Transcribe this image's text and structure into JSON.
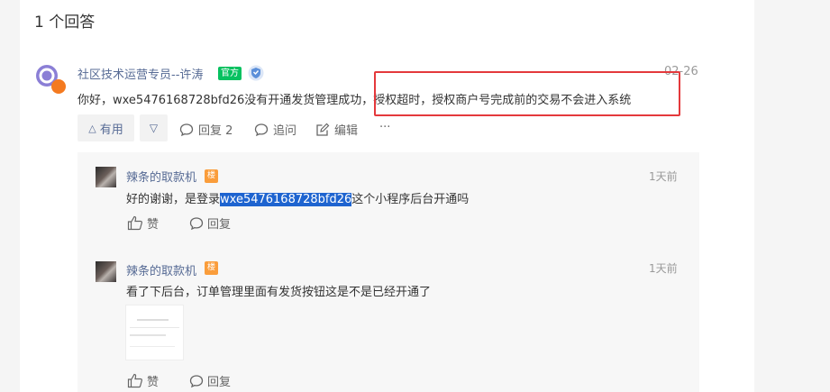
{
  "answer_count": "1 个回答",
  "answer": {
    "author": "社区技术运营专员--许涛",
    "official_badge": "官方",
    "date": "02-26",
    "text": "你好，wxe5476168728bfd26没有开通发货管理成功，授权超时，授权商户号完成前的交易不会进入系统",
    "actions": {
      "like": "有用",
      "reply": "回复 2",
      "follow_up": "追问",
      "edit": "编辑",
      "more": "···"
    }
  },
  "replies": [
    {
      "author": "辣条的取款机",
      "floor_badge": "楼",
      "date": "1天前",
      "text_before": "好的谢谢，是登录",
      "text_selected": "wxe5476168728bfd26",
      "text_after": "这个小程序后台开通吗",
      "like": "赞",
      "reply": "回复"
    },
    {
      "author": "辣条的取款机",
      "floor_badge": "楼",
      "date": "1天前",
      "text": "看了下后台，订单管理里面有发货按钮这是不是已经开通了",
      "like": "赞",
      "reply": "回复"
    }
  ],
  "colors": {
    "link": "#576b95",
    "official": "#07c160",
    "floor": "#fa9d3b",
    "highlight_box": "#e4393c",
    "selection": "#1e64d0"
  }
}
